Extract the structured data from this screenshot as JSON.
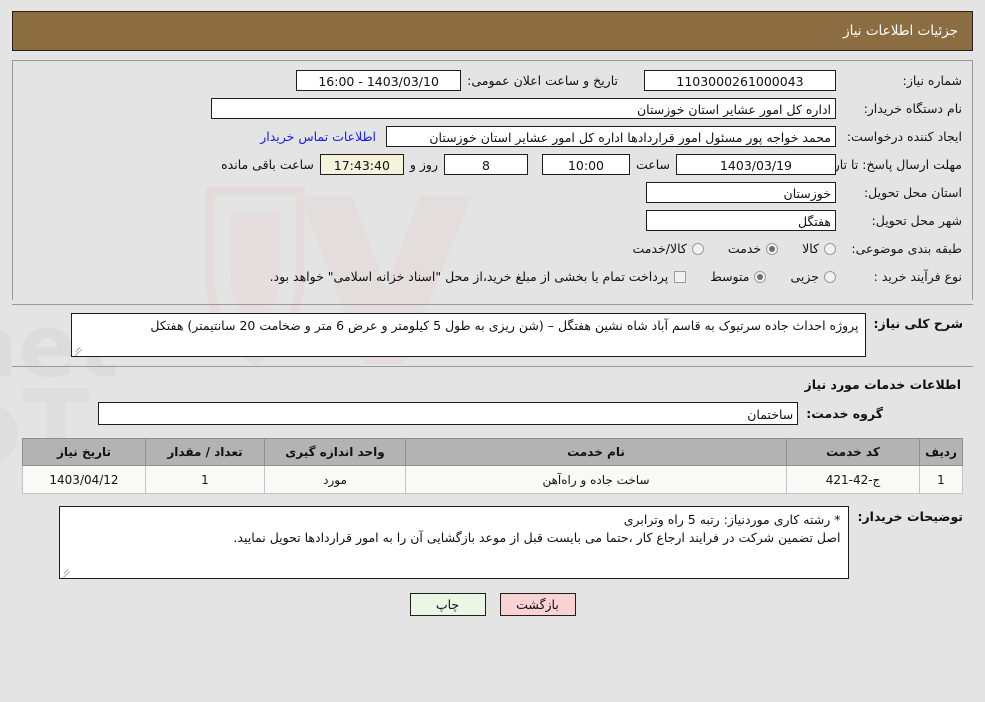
{
  "header": {
    "title": "جزئیات اطلاعات نیاز"
  },
  "colors": {
    "header_bg": "#8c6d42",
    "page_bg": "#e4e4e4",
    "link": "#1a1aee",
    "table_header_bg": "#b3b3b3",
    "countdown_bg": "#f5f3dc",
    "print_btn_bg": "#e9f7e4",
    "back_btn_bg": "#f9d3d3"
  },
  "watermark": {
    "text": "AriaTender.net"
  },
  "form": {
    "need_number_label": "شماره نیاز:",
    "need_number_value": "1103000261000043",
    "public_announce_label": "تاریخ و ساعت اعلان عمومی:",
    "public_announce_value": "1403/03/10 - 16:00",
    "buyer_org_label": "نام دستگاه خریدار:",
    "buyer_org_value": "اداره کل امور عشایر استان خوزستان",
    "requester_label": "ایجاد کننده درخواست:",
    "requester_value": "محمد خواجه پور مسئول امور قراردادها اداره کل امور عشایر استان خوزستان",
    "contact_link": "اطلاعات تماس خریدار",
    "deadline_label": "مهلت ارسال پاسخ: تا تاریخ:",
    "deadline_date": "1403/03/19",
    "deadline_time_label": "ساعت",
    "deadline_time": "10:00",
    "remaining_days": "8",
    "remaining_days_label": "روز و",
    "remaining_clock": "17:43:40",
    "remaining_suffix": "ساعت باقی مانده",
    "province_label": "استان محل تحویل:",
    "province_value": "خوزستان",
    "city_label": "شهر محل تحویل:",
    "city_value": "هفتگل",
    "category_label": "طبقه بندی موضوعی:",
    "category_options": [
      {
        "label": "کالا",
        "selected": false
      },
      {
        "label": "خدمت",
        "selected": true
      },
      {
        "label": "کالا/خدمت",
        "selected": false
      }
    ],
    "purchase_type_label": "نوع فرآیند خرید :",
    "purchase_type_options": [
      {
        "label": "جزیی",
        "selected": false
      },
      {
        "label": "متوسط",
        "selected": true
      }
    ],
    "treasury_checkbox_label": "پرداخت تمام یا بخشی از مبلغ خرید،از محل \"اسناد خزانه اسلامی\" خواهد بود.",
    "treasury_checked": false
  },
  "description": {
    "label": "شرح کلی نیاز:",
    "value": "پروژه احداث جاده سرتیوک به قاسم آباد شاه نشین هفتگل  – (شن ریزی به طول 5 کیلومتر و عرض 6 متر و ضخامت 20 سانتیمتر) هفتکل"
  },
  "services_section": {
    "title": "اطلاعات خدمات مورد نیاز",
    "group_label": "گروه خدمت:",
    "group_value": "ساختمان"
  },
  "table": {
    "columns": [
      "ردیف",
      "کد خدمت",
      "نام خدمت",
      "واحد اندازه گیری",
      "تعداد / مقدار",
      "تاریخ نیاز"
    ],
    "rows": [
      {
        "row_no": "1",
        "service_code": "ج-42-421",
        "service_name": "ساخت جاده و راه‌آهن",
        "unit": "مورد",
        "quantity": "1",
        "need_date": "1403/04/12"
      }
    ]
  },
  "notes": {
    "label": "توضیحات خریدار:",
    "line1": "* رشته کاری موردنیاز:   رتبه 5 راه وترابری",
    "line2": "اصل تضمین شرکت در فرایند ارجاع کار ،حتما می بایست قبل از موعد بازگشایی  آن را به امور قراردادها تحویل نمایید."
  },
  "footer": {
    "print_label": "چاپ",
    "back_label": "بازگشت"
  }
}
